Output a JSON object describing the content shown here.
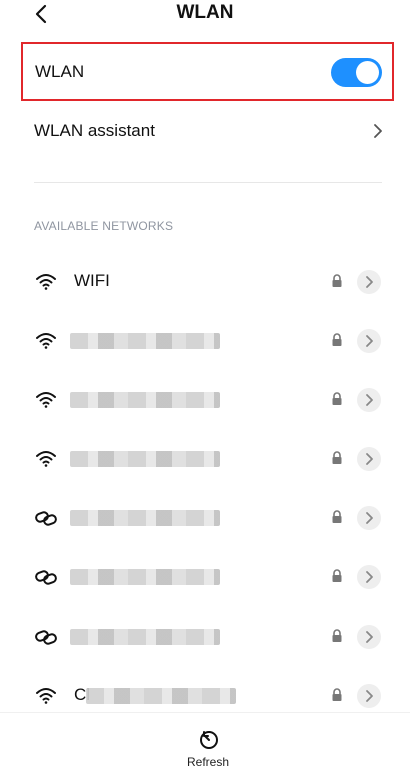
{
  "header": {
    "title": "WLAN",
    "back_icon": "back-arrow-icon"
  },
  "wlan": {
    "label": "WLAN",
    "enabled": true,
    "accent": "#1e90ff",
    "highlight": "#e1272b"
  },
  "assistant": {
    "label": "WLAN assistant",
    "icon": "chevron-right-icon"
  },
  "networks_section": {
    "title": "AVAILABLE NETWORKS",
    "items": [
      {
        "name": "WIFI",
        "type": "wifi",
        "secured": true
      },
      {
        "name": "",
        "type": "wifi",
        "secured": true
      },
      {
        "name": "",
        "type": "wifi",
        "secured": true
      },
      {
        "name": "",
        "type": "wifi",
        "secured": true
      },
      {
        "name": "",
        "type": "link",
        "secured": true
      },
      {
        "name": "",
        "type": "link",
        "secured": true
      },
      {
        "name": "",
        "type": "link",
        "secured": true
      },
      {
        "name": "Cl",
        "type": "wifi",
        "secured": true
      }
    ]
  },
  "bottom_bar": {
    "refresh_label": "Refresh",
    "refresh_icon": "refresh-icon"
  }
}
